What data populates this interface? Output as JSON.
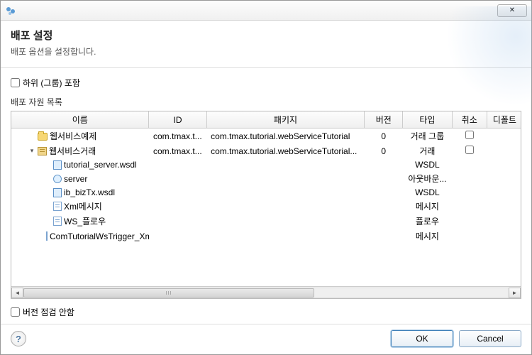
{
  "header": {
    "title": "배포 설정",
    "subtitle": "배포 옵션을 설정합니다."
  },
  "includeSubgroupsLabel": "하위 (그룹) 포함",
  "resourceListLabel": "배포 자원 목록",
  "skipVersionCheckLabel": "버전 점검 안함",
  "columns": {
    "name": "이름",
    "id": "ID",
    "pkg": "패키지",
    "version": "버전",
    "type": "타입",
    "cancel": "취소",
    "default": "디폴트"
  },
  "rows": [
    {
      "level": 1,
      "expander": "",
      "iconClass": "icon-folder",
      "iconName": "folder-icon",
      "name": "웹서비스예제",
      "id": "com.tmax.t...",
      "pkg": "com.tmax.tutorial.webServiceTutorial",
      "version": "0",
      "type": "거래 그룹",
      "hasCancelCheckbox": true
    },
    {
      "level": 1,
      "expander": "▾",
      "iconClass": "icon-pkg",
      "iconName": "package-icon",
      "name": "웹서비스거래",
      "id": "com.tmax.t...",
      "pkg": "com.tmax.tutorial.webServiceTutorial...",
      "version": "0",
      "type": "거래",
      "hasCancelCheckbox": true
    },
    {
      "level": 2,
      "expander": "",
      "iconClass": "icon-wsdl icon-file",
      "iconName": "wsdl-file-icon",
      "name": "tutorial_server.wsdl",
      "id": "",
      "pkg": "",
      "version": "",
      "type": "WSDL",
      "hasCancelCheckbox": false
    },
    {
      "level": 2,
      "expander": "",
      "iconClass": "icon-server",
      "iconName": "server-icon",
      "name": "server",
      "id": "",
      "pkg": "",
      "version": "",
      "type": "아웃바운...",
      "hasCancelCheckbox": false
    },
    {
      "level": 2,
      "expander": "",
      "iconClass": "icon-wsdl icon-file",
      "iconName": "wsdl-file-icon",
      "name": "ib_bizTx.wsdl",
      "id": "",
      "pkg": "",
      "version": "",
      "type": "WSDL",
      "hasCancelCheckbox": false
    },
    {
      "level": 2,
      "expander": "",
      "iconClass": "icon-msg",
      "iconName": "message-icon",
      "name": "Xml메시지",
      "id": "",
      "pkg": "",
      "version": "",
      "type": "메시지",
      "hasCancelCheckbox": false
    },
    {
      "level": 2,
      "expander": "",
      "iconClass": "icon-msg",
      "iconName": "flow-icon",
      "name": "WS_플로우",
      "id": "",
      "pkg": "",
      "version": "",
      "type": "플로우",
      "hasCancelCheckbox": false
    },
    {
      "level": 2,
      "expander": "",
      "iconClass": "icon-msg",
      "iconName": "message-icon",
      "name": "ComTutorialWsTrigger_Xm",
      "id": "",
      "pkg": "",
      "version": "",
      "type": "메시지",
      "hasCancelCheckbox": false
    }
  ],
  "buttons": {
    "ok": "OK",
    "cancel": "Cancel"
  },
  "closeGlyph": "✕"
}
